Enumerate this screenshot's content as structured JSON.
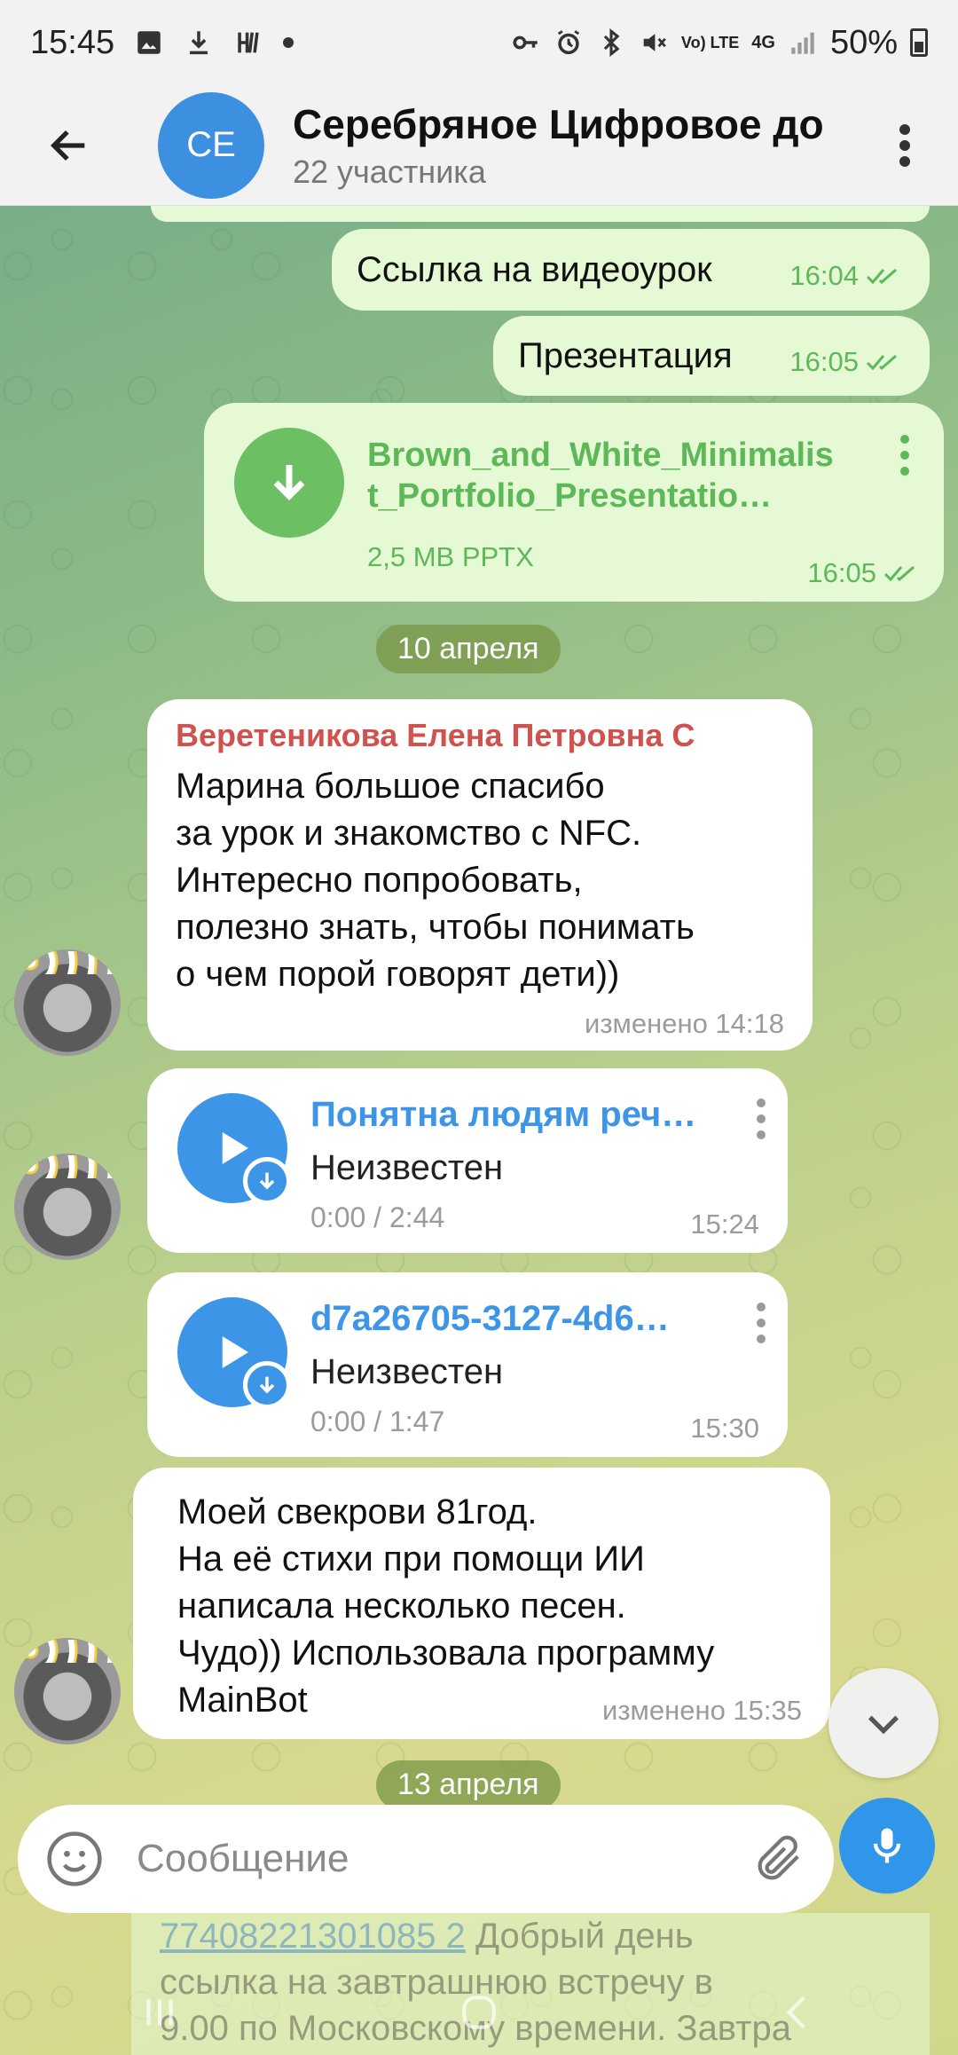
{
  "status_bar": {
    "time": "15:45",
    "battery": "50%",
    "network_volte": "Vo) LTE",
    "network_4g": "4G"
  },
  "header": {
    "avatar_initials": "CE",
    "title": "Серебряное Цифровое до",
    "subtitle": "22 участника"
  },
  "messages": {
    "out_link": {
      "text": "Ссылка на видеоурок",
      "time": "16:04"
    },
    "out_presentation": {
      "text": "Презентация",
      "time": "16:05"
    },
    "out_file": {
      "name_line1": "Brown_and_White_Minimalis",
      "name_line2": "t_Portfolio_Presentatio…",
      "meta": "2,5 MB PPTX",
      "time": "16:05"
    },
    "date1": "10 апреля",
    "in_text1": {
      "sender": "Веретеникова Елена Петровна С",
      "lines": [
        "Марина большое спасибо",
        "за урок и знакомство с NFC.",
        "Интересно попробовать,",
        "полезно знать, чтобы понимать",
        "о чем порой говорят дети))"
      ],
      "time": "изменено 14:18"
    },
    "in_audio1": {
      "title": "Понятна людям реч…",
      "artist": "Неизвестен",
      "duration": "0:00 / 2:44",
      "time": "15:24"
    },
    "in_audio2": {
      "title": "d7a26705-3127-4d6…",
      "artist": "Неизвестен",
      "duration": "0:00 / 1:47",
      "time": "15:30"
    },
    "in_text2": {
      "lines": [
        "Моей свекрови 81год.",
        "На её стихи при помощи ИИ",
        "написала несколько песен.",
        "Чудо)) Использовала программу",
        "MainBot"
      ],
      "time": "изменено 15:35"
    },
    "date2": "13 апреля",
    "peek": {
      "link": "77408221301085 2",
      "lines": [
        "Добрый день",
        "ссылка на завтрашнюю встречу в",
        "9.00 по Московскому времени. Завтра"
      ]
    }
  },
  "input": {
    "placeholder": "Сообщение"
  },
  "colors": {
    "outgoing_bubble": "#e6f9d5",
    "incoming_bubble": "#ffffff",
    "accent_blue": "#3d95e8",
    "accent_green": "#5db858",
    "sender_name": "#d0524e"
  }
}
